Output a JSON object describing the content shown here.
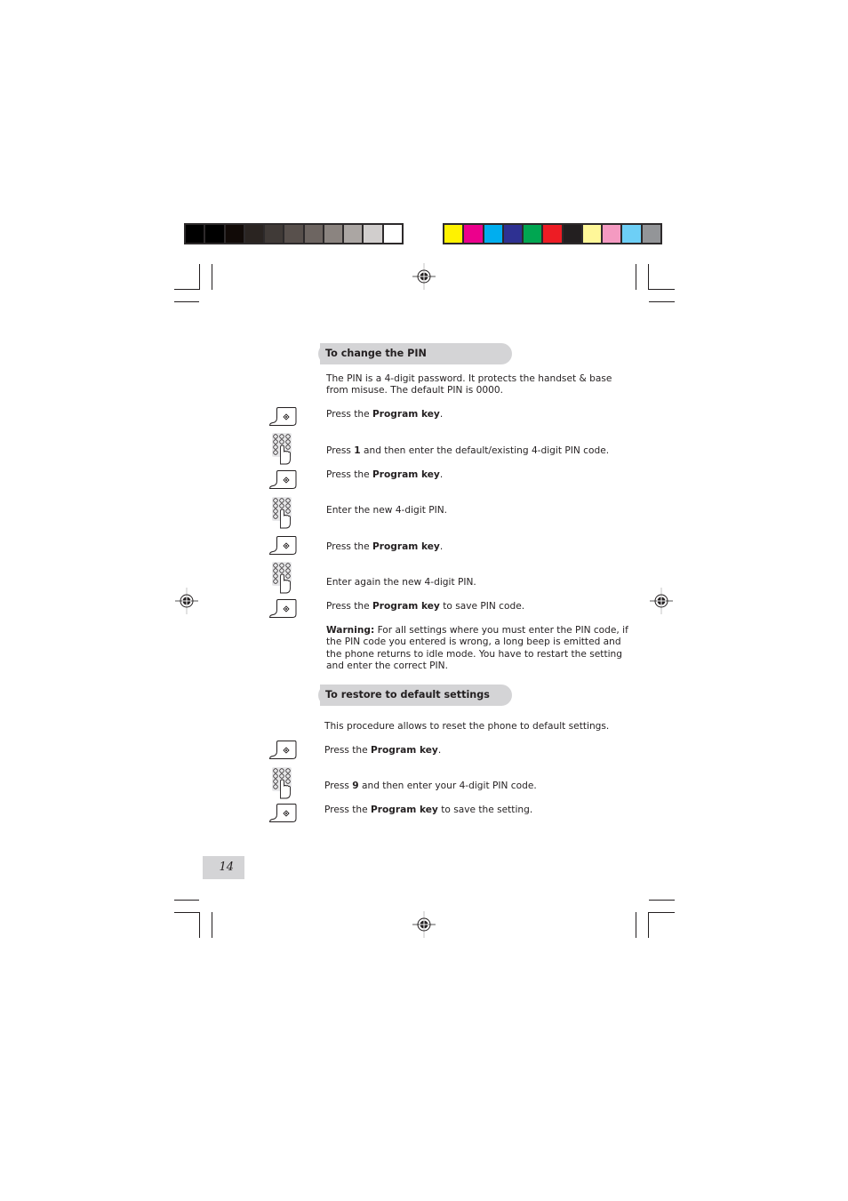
{
  "color_bars": {
    "grayscale": [
      "#000000",
      "#000000",
      "#110a07",
      "#2a2421",
      "#403a37",
      "#58504c",
      "#6d6561",
      "#8b8480",
      "#aba6a3",
      "#d1cecd",
      "#ffffff"
    ],
    "process": [
      "#fff200",
      "#ec008c",
      "#00aeef",
      "#2e3192",
      "#00a651",
      "#ed1c24",
      "#231f20",
      "#fff799",
      "#f49ac1",
      "#6dcff6",
      "#939598"
    ]
  },
  "icons": {
    "program_key": "program-key-icon",
    "keypad": "keypad-icon",
    "registration": "registration-mark-icon"
  },
  "section_change_pin": {
    "title": "To change the PIN",
    "intro_line1": "The PIN is a 4-digit password. It protects the handset & base",
    "intro_line2": "from misuse. The default PIN is 0000.",
    "steps": [
      {
        "icon": "program-key",
        "pre": "Press the ",
        "bold": "Program key",
        "post": "."
      },
      {
        "icon": "keypad",
        "pre": "Press ",
        "bold": "1",
        "post": " and then enter the default/existing 4-digit PIN code."
      },
      {
        "icon": "program-key",
        "pre": "Press the ",
        "bold": "Program key",
        "post": "."
      },
      {
        "icon": "keypad",
        "pre": "Enter the new 4-digit PIN.",
        "bold": "",
        "post": ""
      },
      {
        "icon": "program-key",
        "pre": "Press the ",
        "bold": "Program key",
        "post": "."
      },
      {
        "icon": "keypad",
        "pre": "Enter again the new 4-digit PIN.",
        "bold": "",
        "post": ""
      },
      {
        "icon": "program-key",
        "pre": "Press the ",
        "bold": "Program key",
        "post": " to save PIN code."
      }
    ],
    "warning_label": "Warning:",
    "warning_line1": " For all settings where you must enter the PIN code, if",
    "warning_line2": "the PIN code you entered is wrong, a long beep is emitted and",
    "warning_line3": "the phone returns to idle mode. You have to restart the setting",
    "warning_line4": "and enter the correct PIN."
  },
  "section_restore": {
    "title": "To restore to default settings",
    "intro": "This procedure allows to reset the phone to default settings.",
    "steps": [
      {
        "icon": "program-key",
        "pre": "Press the ",
        "bold": "Program key",
        "post": "."
      },
      {
        "icon": "keypad",
        "pre": "Press ",
        "bold": "9",
        "post": " and then enter your 4-digit PIN code."
      },
      {
        "icon": "program-key",
        "pre": "Press the ",
        "bold": "Program key",
        "post": " to save the setting."
      }
    ]
  },
  "page_number": "14"
}
